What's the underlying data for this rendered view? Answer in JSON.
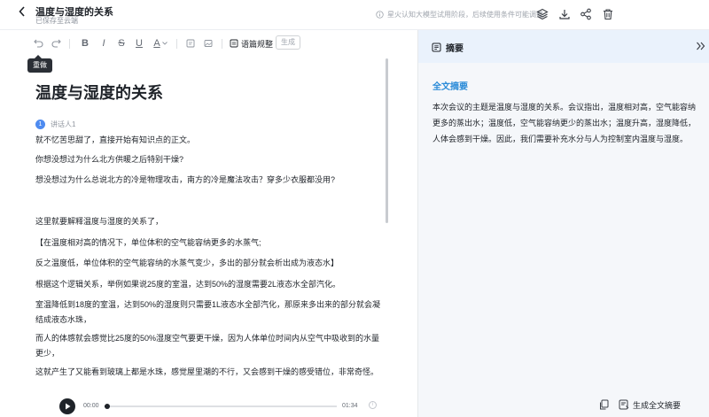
{
  "header": {
    "title": "温度与湿度的关系",
    "saved_status": "已保存至云端",
    "notice": "星火认知大模型试用阶段，后续使用条件可能调整。"
  },
  "toolbar": {
    "tooltip": "重做",
    "layout_label": "语篇规整",
    "generate_label": "生成"
  },
  "editor": {
    "heading": "温度与湿度的关系",
    "speaker": {
      "index": "1",
      "name": "讲话人1"
    },
    "paragraphs": [
      "就不忆苦思甜了，直接开始有知识点的正文。",
      "你想没想过为什么北方供暖之后特别干燥?",
      "想没想过为什么总说北方的冷是物理攻击，南方的冷是魔法攻击？穿多少衣服都没用?",
      "这里就要解释温度与湿度的关系了，",
      "【在温度相对高的情况下，单位体积的空气能容纳更多的水蒸气;",
      "反之温度低，单位体积的空气能容纳的水蒸气变少，多出的部分就会析出成为液态水】",
      "根据这个逻辑关系，举例如果说25度的室温，达到50%的湿度需要2L液态水全部汽化。",
      "室温降低到18度的室温，达到50%的湿度则只需要1L液态水全部汽化，那原来多出来的部分就会凝结成液态水珠，",
      "而人的体感就会感觉比25度的50%湿度空气要更干燥，因为人体单位时间内从空气中吸收到的水量更少，",
      "这就产生了又能看到玻璃上都是水珠，感觉屋里潮的不行，又会感到干燥的感受错位，非常奇怪。"
    ]
  },
  "player": {
    "current": "00:00",
    "total": "01:34",
    "progress_fraction": 0.01
  },
  "panel": {
    "title": "摘要",
    "section_title": "全文摘要",
    "summary": "本次会议的主题是温度与湿度的关系。会议指出，温度相对高，空气能容纳更多的蒸出水；温度低，空气能容纳更少的蒸出水；温度升高，湿度降低，人体会感到干燥。因此，我们需要补充水分与人为控制室内温度与湿度。",
    "generate_label": "生成全文摘要"
  },
  "colors": {
    "accent": "#2a8bd8",
    "panel_header": "#eaf2fc",
    "panel_bg": "#f5f7fa",
    "speaker_badge": "#4e8bf0"
  },
  "icons": [
    "back-icon",
    "info-icon",
    "layers-icon",
    "download-icon",
    "share-icon",
    "trash-icon",
    "undo-icon",
    "redo-icon",
    "bold-icon",
    "italic-icon",
    "strikethrough-icon",
    "underline-icon",
    "font-color-icon",
    "comment-icon",
    "image-icon",
    "format-icon",
    "play-icon",
    "summary-icon",
    "collapse-icon",
    "copy-icon",
    "generate-icon"
  ]
}
